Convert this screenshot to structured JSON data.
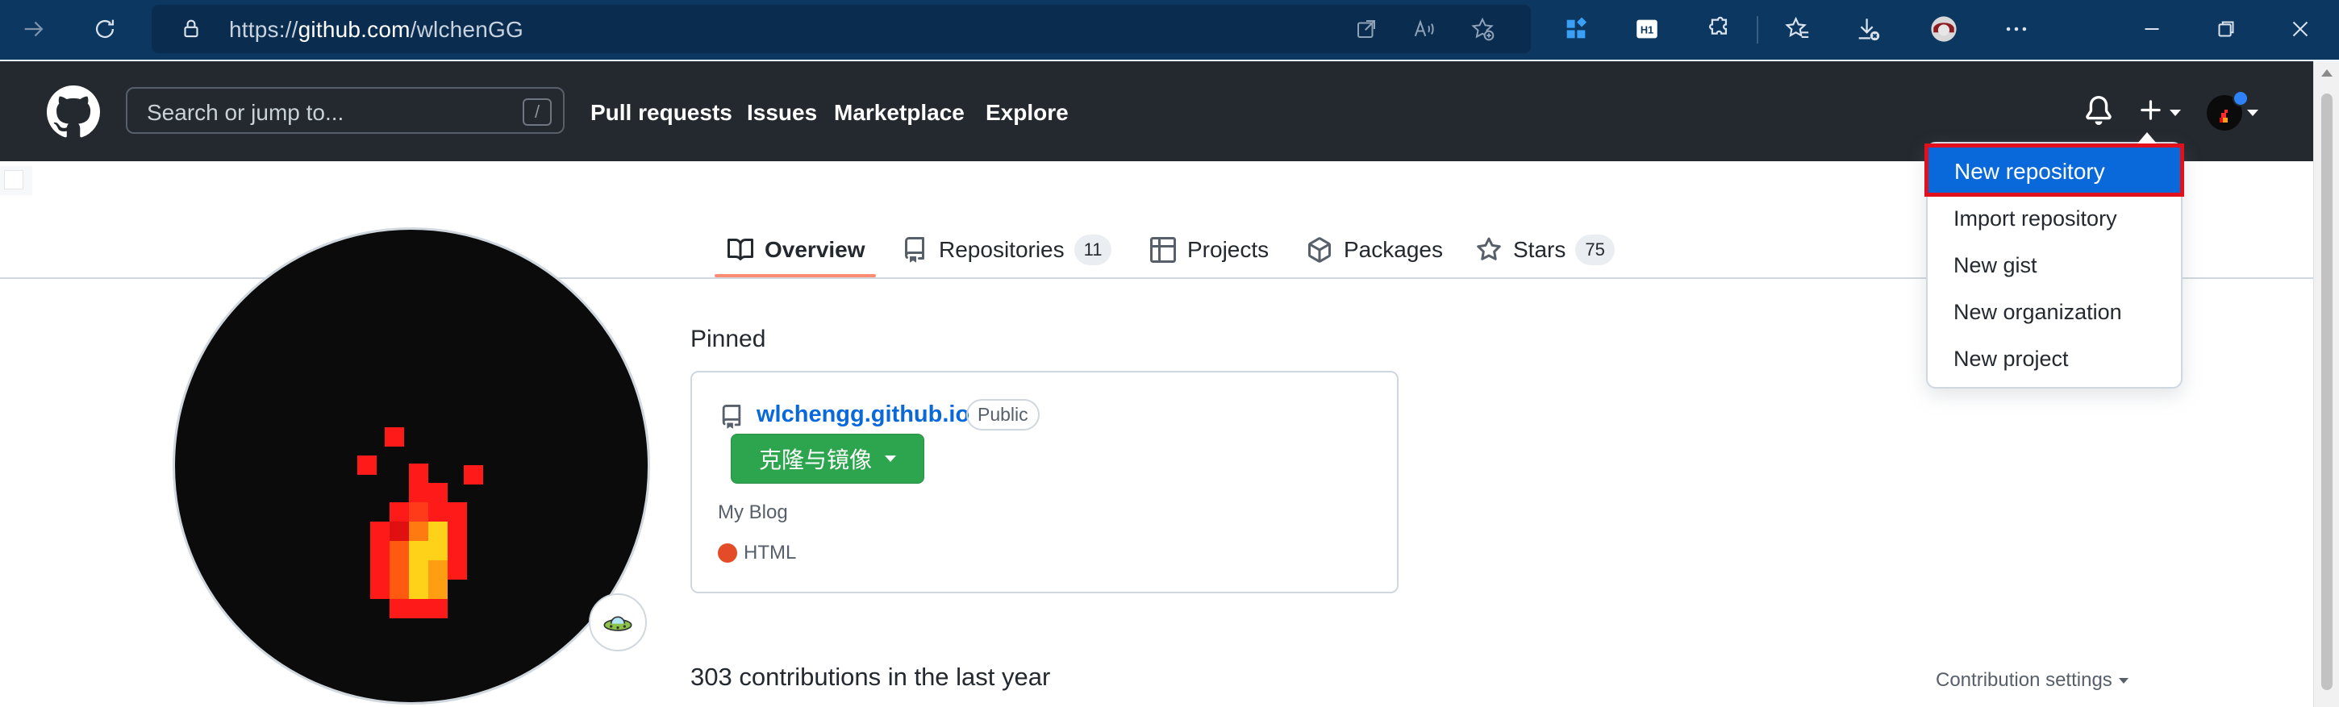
{
  "browser": {
    "url_prefix": "https://",
    "url_host": "github.com",
    "url_path": "/wlchenGG",
    "toolbar_icons": [
      "forward-icon",
      "refresh-icon",
      "lock-icon",
      "open-in-app-icon",
      "read-aloud-icon",
      "add-favorite-icon",
      "extension-icon",
      "h1-icon",
      "puzzle-icon",
      "favorites-icon",
      "downloads-icon",
      "profile-icon",
      "more-icon",
      "minimize-icon",
      "restore-icon",
      "close-icon"
    ]
  },
  "header": {
    "search_placeholder": "Search or jump to...",
    "search_shortcut": "/",
    "nav": [
      "Pull requests",
      "Issues",
      "Marketplace",
      "Explore"
    ]
  },
  "dropdown": {
    "items": [
      "New repository",
      "Import repository",
      "New gist",
      "New organization",
      "New project"
    ],
    "selected_index": 0,
    "highlight_color": "#0969da",
    "annotation_color": "#e0101d"
  },
  "tabs": [
    {
      "label": "Overview",
      "icon": "book-icon",
      "count": null,
      "active": true
    },
    {
      "label": "Repositories",
      "icon": "repo-icon",
      "count": "11",
      "active": false
    },
    {
      "label": "Projects",
      "icon": "table-icon",
      "count": null,
      "active": false
    },
    {
      "label": "Packages",
      "icon": "package-icon",
      "count": null,
      "active": false
    },
    {
      "label": "Stars",
      "icon": "star-icon",
      "count": "75",
      "active": false
    }
  ],
  "pinned": {
    "title": "Pinned",
    "repo_name": "wlchengg.github.io",
    "visibility": "Public",
    "clone_button": "克隆与镜像",
    "description": "My Blog",
    "language": "HTML",
    "language_color": "#e34c26"
  },
  "contributions": {
    "summary": "303 contributions in the last year",
    "settings_label": "Contribution settings"
  }
}
